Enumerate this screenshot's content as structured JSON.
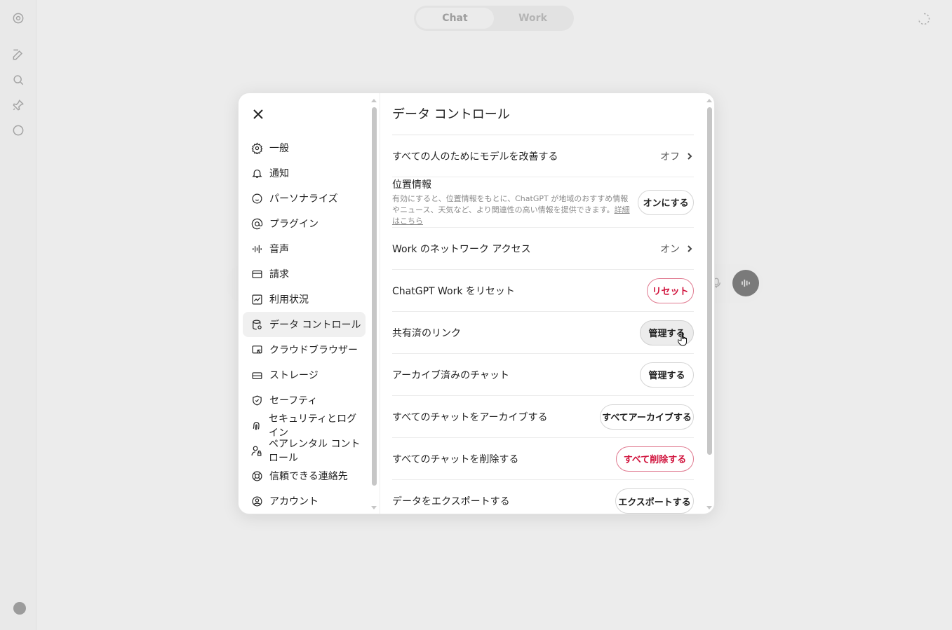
{
  "top_tabs": [
    {
      "label": "Chat"
    },
    {
      "label": "Work"
    }
  ],
  "rail_icons": [
    "app-logo-icon",
    "new-chat-icon",
    "search-icon",
    "pin-icon",
    "chat-bubble-icon"
  ],
  "settings": {
    "nav": [
      {
        "label": "一般",
        "icon": "gear-icon"
      },
      {
        "label": "通知",
        "icon": "bell-icon"
      },
      {
        "label": "パーソナライズ",
        "icon": "personalize-icon"
      },
      {
        "label": "プラグイン",
        "icon": "at-sign-icon"
      },
      {
        "label": "音声",
        "icon": "waveform-icon"
      },
      {
        "label": "請求",
        "icon": "credit-card-icon"
      },
      {
        "label": "利用状況",
        "icon": "chart-icon"
      },
      {
        "label": "データ コントロール",
        "icon": "database-icon"
      },
      {
        "label": "クラウドブラウザー",
        "icon": "cloud-browser-icon"
      },
      {
        "label": "ストレージ",
        "icon": "storage-icon"
      },
      {
        "label": "セーフティ",
        "icon": "shield-icon"
      },
      {
        "label": "セキュリティとログイン",
        "icon": "fingerprint-icon"
      },
      {
        "label": "ペアレンタル コントロール",
        "icon": "parental-icon"
      },
      {
        "label": "信頼できる連絡先",
        "icon": "lifebuoy-icon"
      },
      {
        "label": "アカウント",
        "icon": "account-icon"
      }
    ],
    "active_nav": "データ コントロール",
    "title": "データ コントロール",
    "rows": {
      "improve_model": {
        "label": "すべての人のためにモデルを改善する",
        "value": "オフ"
      },
      "location": {
        "label": "位置情報",
        "desc": "有効にすると、位置情報をもとに、ChatGPT が地域のおすすめ情報やニュース、天気など、より関連性の高い情報を提供できます。",
        "link": "詳細はこちら",
        "button": "オンにする"
      },
      "network_access": {
        "label": "Work のネットワーク アクセス",
        "value": "オン"
      },
      "reset_work": {
        "label": "ChatGPT Work をリセット",
        "button": "リセット"
      },
      "shared_links": {
        "label": "共有済のリンク",
        "button": "管理する"
      },
      "archived_chats": {
        "label": "アーカイブ済みのチャット",
        "button": "管理する"
      },
      "archive_all": {
        "label": "すべてのチャットをアーカイブする",
        "button": "すべてアーカイブする"
      },
      "delete_all": {
        "label": "すべてのチャットを削除する",
        "button": "すべて削除する"
      },
      "export": {
        "label": "データをエクスポートする",
        "button": "エクスポートする"
      }
    }
  },
  "colors": {
    "danger": "#d0103a",
    "backdrop": "#ececec",
    "surface": "#ffffff"
  }
}
